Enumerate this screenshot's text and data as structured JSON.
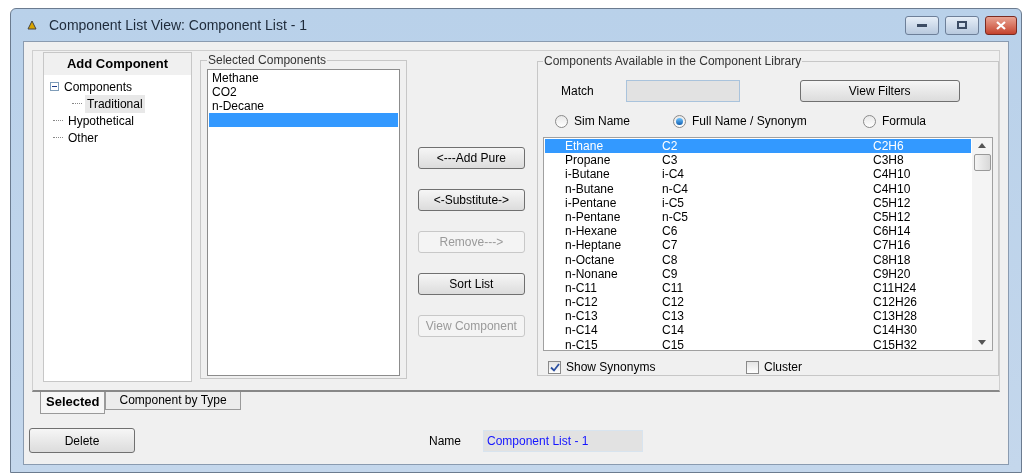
{
  "window": {
    "title": "Component List View: Component List - 1"
  },
  "tree": {
    "header": "Add Component",
    "items": [
      {
        "label": "Components",
        "expanded": true,
        "selected": false,
        "children": [
          {
            "label": "Traditional",
            "selected": true
          }
        ]
      },
      {
        "label": "Hypothetical",
        "selected": false
      },
      {
        "label": "Other",
        "selected": false
      }
    ]
  },
  "selected_components": {
    "title": "Selected Components",
    "items": [
      {
        "text": "Methane",
        "selected": false
      },
      {
        "text": "CO2",
        "selected": false
      },
      {
        "text": "n-Decane",
        "selected": false
      },
      {
        "selected": true
      }
    ]
  },
  "actions": [
    {
      "label": "<---Add Pure",
      "disabled": false
    },
    {
      "label": "<-Substitute->",
      "disabled": false
    },
    {
      "label": "Remove--->",
      "disabled": true
    },
    {
      "label": "Sort List",
      "disabled": false
    },
    {
      "label": "View Component",
      "disabled": true
    }
  ],
  "library": {
    "title": "Components Available in the Component Library",
    "match_label": "Match",
    "view_filters": "View Filters",
    "radios": [
      {
        "label": "Sim Name",
        "selected": false
      },
      {
        "label": "Full Name / Synonym",
        "selected": true
      },
      {
        "label": "Formula",
        "selected": false
      }
    ],
    "rows": [
      {
        "name": "Ethane",
        "synonym": "C2",
        "formula": "C2H6",
        "selected": true
      },
      {
        "name": "Propane",
        "synonym": "C3",
        "formula": "C3H8",
        "selected": false
      },
      {
        "name": "i-Butane",
        "synonym": "i-C4",
        "formula": "C4H10",
        "selected": false
      },
      {
        "name": "n-Butane",
        "synonym": "n-C4",
        "formula": "C4H10",
        "selected": false
      },
      {
        "name": "i-Pentane",
        "synonym": "i-C5",
        "formula": "C5H12",
        "selected": false
      },
      {
        "name": "n-Pentane",
        "synonym": "n-C5",
        "formula": "C5H12",
        "selected": false
      },
      {
        "name": "n-Hexane",
        "synonym": "C6",
        "formula": "C6H14",
        "selected": false
      },
      {
        "name": "n-Heptane",
        "synonym": "C7",
        "formula": "C7H16",
        "selected": false
      },
      {
        "name": "n-Octane",
        "synonym": "C8",
        "formula": "C8H18",
        "selected": false
      },
      {
        "name": "n-Nonane",
        "synonym": "C9",
        "formula": "C9H20",
        "selected": false
      },
      {
        "name": "n-C11",
        "synonym": "C11",
        "formula": "C11H24",
        "selected": false
      },
      {
        "name": "n-C12",
        "synonym": "C12",
        "formula": "C12H26",
        "selected": false
      },
      {
        "name": "n-C13",
        "synonym": "C13",
        "formula": "C13H28",
        "selected": false
      },
      {
        "name": "n-C14",
        "synonym": "C14",
        "formula": "C14H30",
        "selected": false
      },
      {
        "name": "n-C15",
        "synonym": "C15",
        "formula": "C15H32",
        "selected": false
      }
    ],
    "checkboxes": [
      {
        "label": "Show Synonyms",
        "checked": true
      },
      {
        "label": "Cluster",
        "checked": false
      }
    ]
  },
  "tabs": [
    {
      "label": "Selected",
      "selected": true
    },
    {
      "label": "Component by Type",
      "selected": false
    }
  ],
  "footer": {
    "delete": "Delete",
    "name_label": "Name",
    "name_value": "Component List - 1"
  }
}
